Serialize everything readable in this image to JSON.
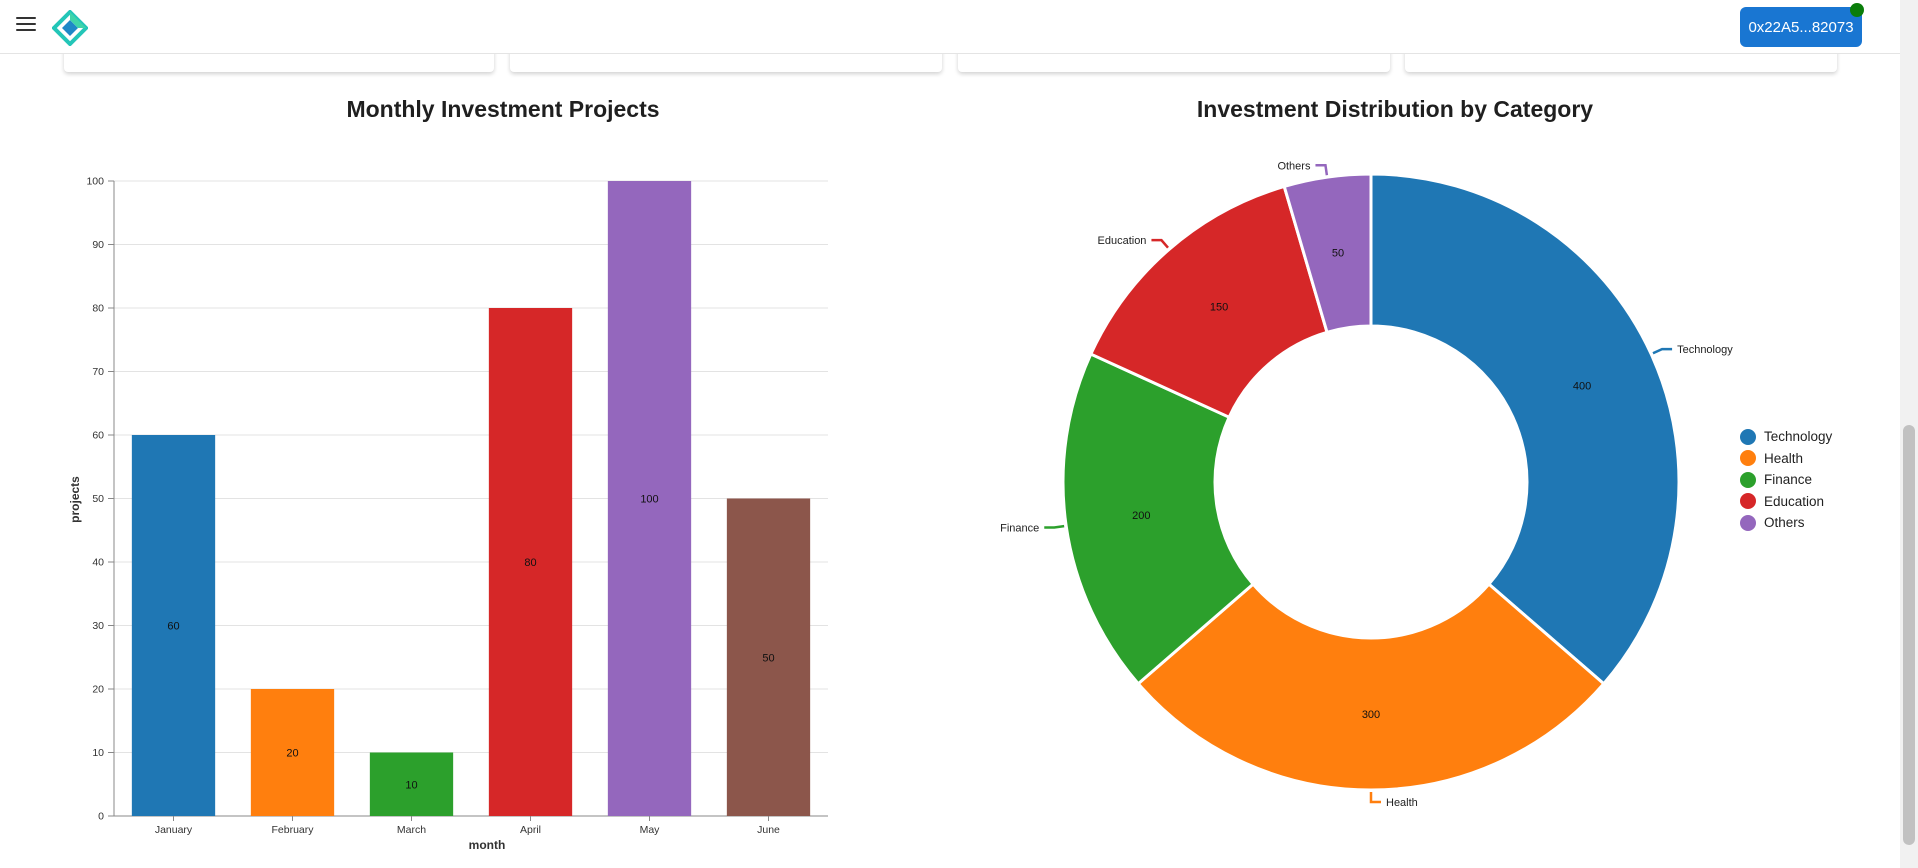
{
  "header": {
    "wallet_label": "0x22A5...82073",
    "menu_icon": "hamburger-menu-icon",
    "logo_icon": "diamond-logo-icon",
    "theme_icon": "moon-icon"
  },
  "colors": {
    "blue": "#1f77b4",
    "orange": "#ff7f0e",
    "green": "#2ca02c",
    "red": "#d62728",
    "purple": "#9467bd",
    "brown": "#8c564b",
    "wallet": "#1976d2"
  },
  "bar_chart_title": "Monthly Investment Projects",
  "pie_chart_title": "Investment Distribution by Category",
  "chart_data": [
    {
      "type": "bar",
      "title": "Monthly Investment Projects",
      "xlabel": "month",
      "ylabel": "projects",
      "ylim": [
        0,
        100
      ],
      "yticks": [
        0,
        10,
        20,
        30,
        40,
        50,
        60,
        70,
        80,
        90,
        100
      ],
      "grid": true,
      "categories": [
        "January",
        "February",
        "March",
        "April",
        "May",
        "June"
      ],
      "values": [
        60,
        20,
        10,
        80,
        100,
        50
      ],
      "colors": [
        "#1f77b4",
        "#ff7f0e",
        "#2ca02c",
        "#d62728",
        "#9467bd",
        "#8c564b"
      ]
    },
    {
      "type": "pie",
      "title": "Investment Distribution by Category",
      "donut": true,
      "legend_position": "right",
      "categories": [
        "Technology",
        "Health",
        "Finance",
        "Education",
        "Others"
      ],
      "values": [
        400,
        300,
        200,
        150,
        50
      ],
      "colors": [
        "#1f77b4",
        "#ff7f0e",
        "#2ca02c",
        "#d62728",
        "#9467bd"
      ]
    }
  ]
}
